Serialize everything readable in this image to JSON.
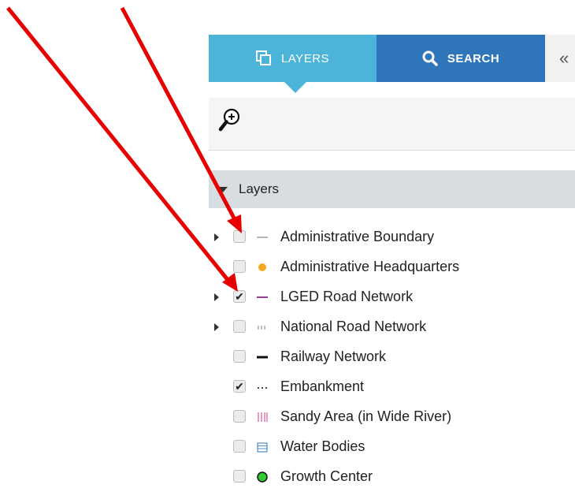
{
  "tabs": {
    "layers": {
      "label": "LAYERS",
      "icon": "layers-icon"
    },
    "search": {
      "label": "SEARCH",
      "icon": "search-icon"
    },
    "collapse": {
      "label": "«"
    }
  },
  "toolbar": {
    "zoom_icon": "zoom-in-icon"
  },
  "section": {
    "title": "Layers"
  },
  "layers": [
    {
      "label": "Administrative Boundary",
      "checked": false,
      "expandable": true,
      "legend": "gray-line"
    },
    {
      "label": "Administrative Headquarters",
      "checked": false,
      "expandable": false,
      "legend": "orange-dot"
    },
    {
      "label": "LGED Road Network",
      "checked": true,
      "expandable": true,
      "legend": "purple-line"
    },
    {
      "label": "National Road Network",
      "checked": false,
      "expandable": true,
      "legend": "dotted-gray-line"
    },
    {
      "label": "Railway Network",
      "checked": false,
      "expandable": false,
      "legend": "black-line"
    },
    {
      "label": "Embankment",
      "checked": true,
      "expandable": false,
      "legend": "dotted-line"
    },
    {
      "label": "Sandy Area (in Wide River)",
      "checked": false,
      "expandable": false,
      "legend": "pink-hatch"
    },
    {
      "label": "Water Bodies",
      "checked": false,
      "expandable": false,
      "legend": "blue-grid"
    },
    {
      "label": "Growth Center",
      "checked": false,
      "expandable": false,
      "legend": "green-circle"
    }
  ],
  "colors": {
    "layers_tab": "#4cb3d9",
    "search_tab": "#2e75ba",
    "annotation_arrow": "#e60000"
  }
}
